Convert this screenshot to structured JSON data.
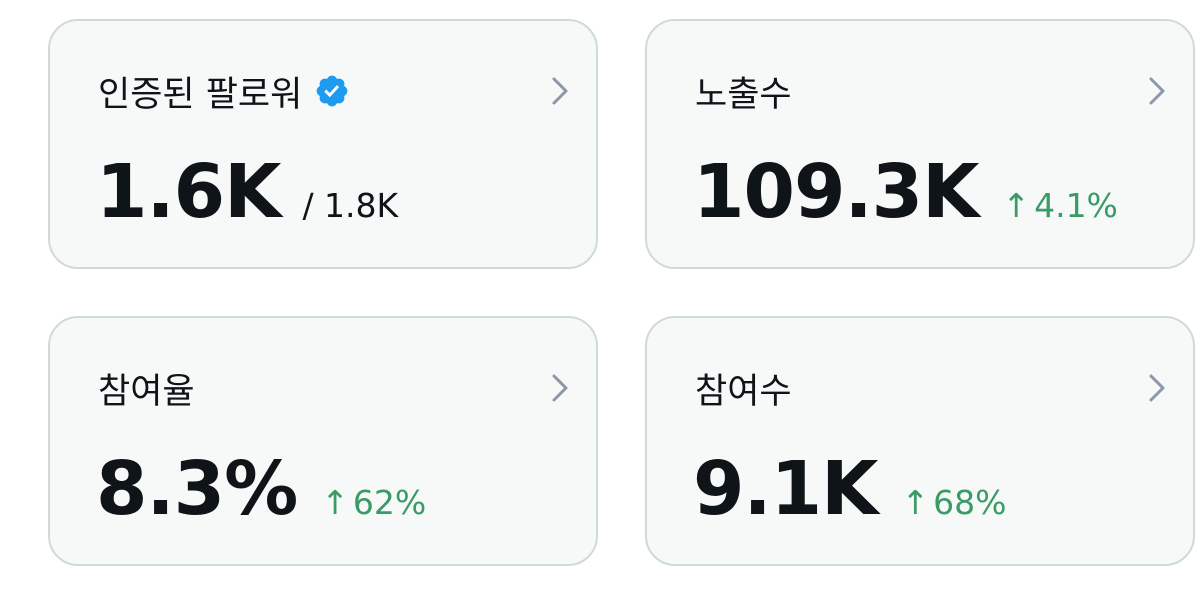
{
  "colors": {
    "card_background": "#f7f9f9",
    "card_border": "#cfd9de",
    "text_primary": "#0f1419",
    "positive_change": "#3a9b66",
    "chevron": "#8b98a5",
    "verified_badge": "#1d9bf0"
  },
  "cards": [
    {
      "title": "인증된 팔로워",
      "title_icon": "verified-badge-icon",
      "value": "1.6K",
      "sub_value": "/ 1.8K",
      "action_icon": "chevron-right-icon"
    },
    {
      "title": "노출수",
      "value": "109.3K",
      "change_arrow": "↑",
      "change": "4.1%",
      "action_icon": "chevron-right-icon"
    },
    {
      "title": "참여율",
      "value": "8.3%",
      "change_arrow": "↑",
      "change": "62%",
      "action_icon": "chevron-right-icon"
    },
    {
      "title": "참여수",
      "value": "9.1K",
      "change_arrow": "↑",
      "change": "68%",
      "action_icon": "chevron-right-icon"
    }
  ]
}
